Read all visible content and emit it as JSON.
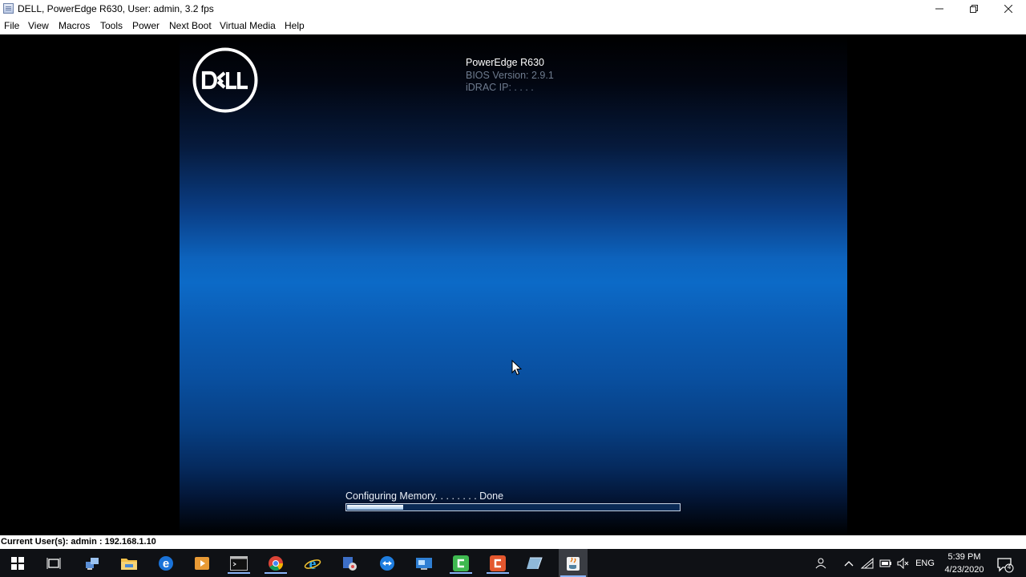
{
  "window": {
    "title": "DELL, PowerEdge R630, User: admin, 3.2 fps"
  },
  "menu": [
    "File",
    "View",
    "Macros",
    "Tools",
    "Power",
    "Next Boot",
    "Virtual Media",
    "Help"
  ],
  "bios": {
    "model": "PowerEdge R630",
    "bios_version": "BIOS Version: 2.9.1",
    "idrac_ip": "iDRAC IP:  . . . .",
    "progress_label": "Configuring Memory. . . . . . . . Done",
    "progress_fraction": 0.17
  },
  "status": {
    "current_users": "Current User(s): admin : 192.168.1.10"
  },
  "taskbar": {
    "apps": [
      "start-icon",
      "task-view-icon",
      "network-manager-icon",
      "file-explorer-icon",
      "edge-icon",
      "media-player-icon",
      "command-prompt-icon",
      "chrome-icon",
      "internet-explorer-icon",
      "network-tool-icon",
      "teamviewer-icon",
      "remote-desktop-icon",
      "camtasia-icon",
      "recorder-icon",
      "notepad-icon",
      "java-icon"
    ],
    "language": "ENG",
    "time": "5:39 PM",
    "date": "4/23/2020",
    "notification_count": "4"
  },
  "colors": {
    "taskbar": "#0f1115",
    "accent": "#0c6ac7"
  }
}
